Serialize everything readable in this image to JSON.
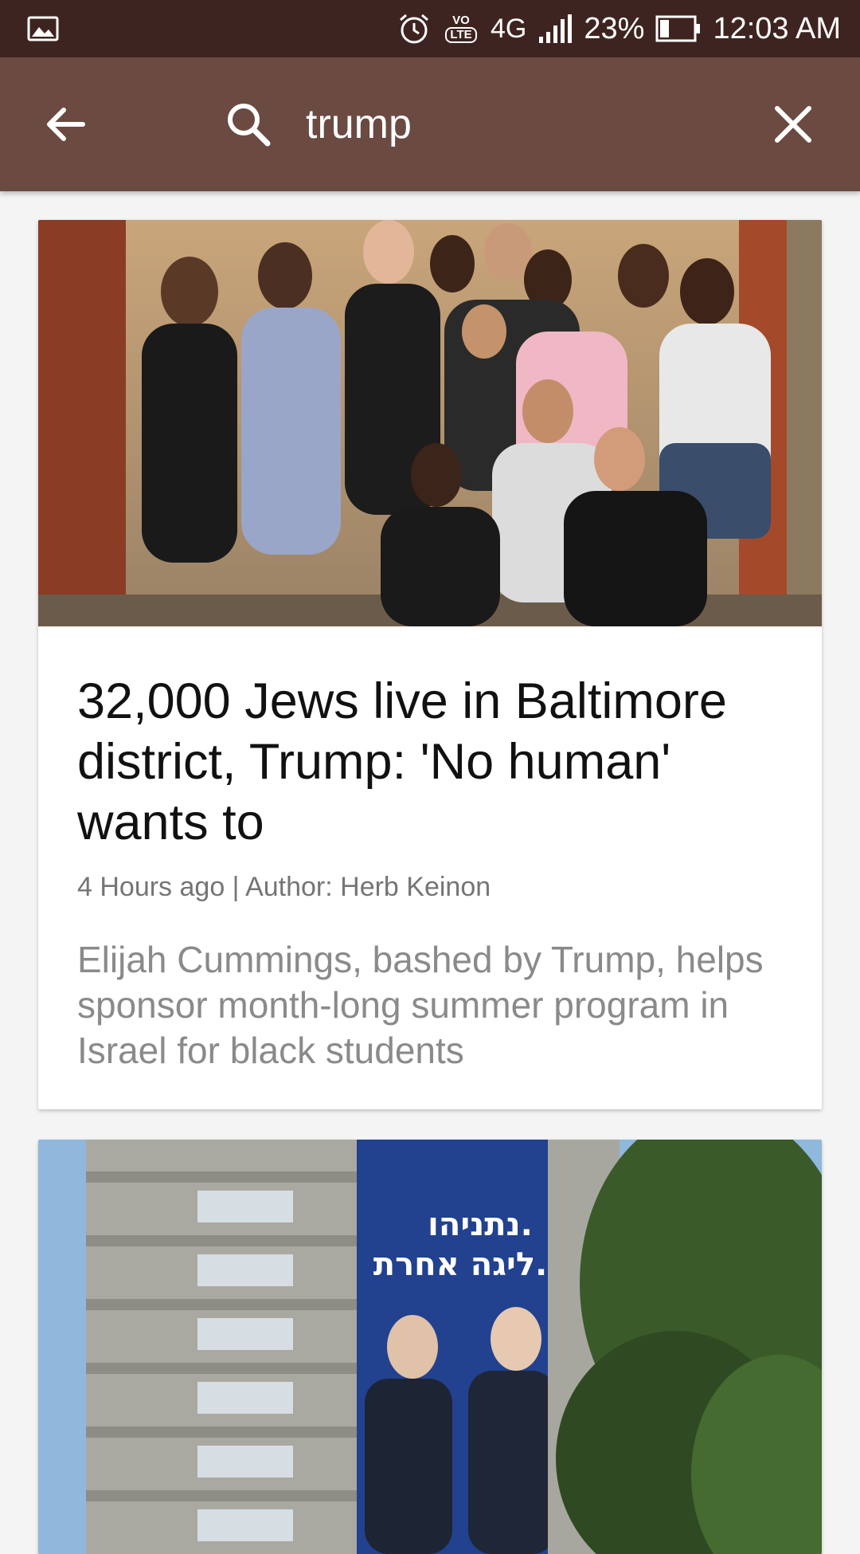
{
  "status_bar": {
    "network": "4G",
    "battery": "23%",
    "time": "12:03 AM",
    "lte_badge_top": "VO",
    "lte_badge_bottom": "LTE"
  },
  "search": {
    "query": "trump"
  },
  "articles": [
    {
      "headline": "32,000 Jews live in Baltimore district, Trump: 'No human' wants to",
      "meta": "4 Hours ago | Author: Herb Keinon",
      "summary": "Elijah Cummings, bashed by Trump, helps sponsor month-long summer program in Israel for black students"
    },
    {
      "banner_line1": "נתניהו.",
      "banner_line2": "ליגה אחרת."
    }
  ],
  "colors": {
    "status_bar": "#3e2420",
    "app_bar": "#6b4a42",
    "background": "#f4f4f4"
  },
  "icons": [
    "gallery-icon",
    "alarm-icon",
    "volte-icon",
    "signal-icon",
    "battery-icon",
    "back-arrow-icon",
    "search-icon",
    "close-icon"
  ]
}
